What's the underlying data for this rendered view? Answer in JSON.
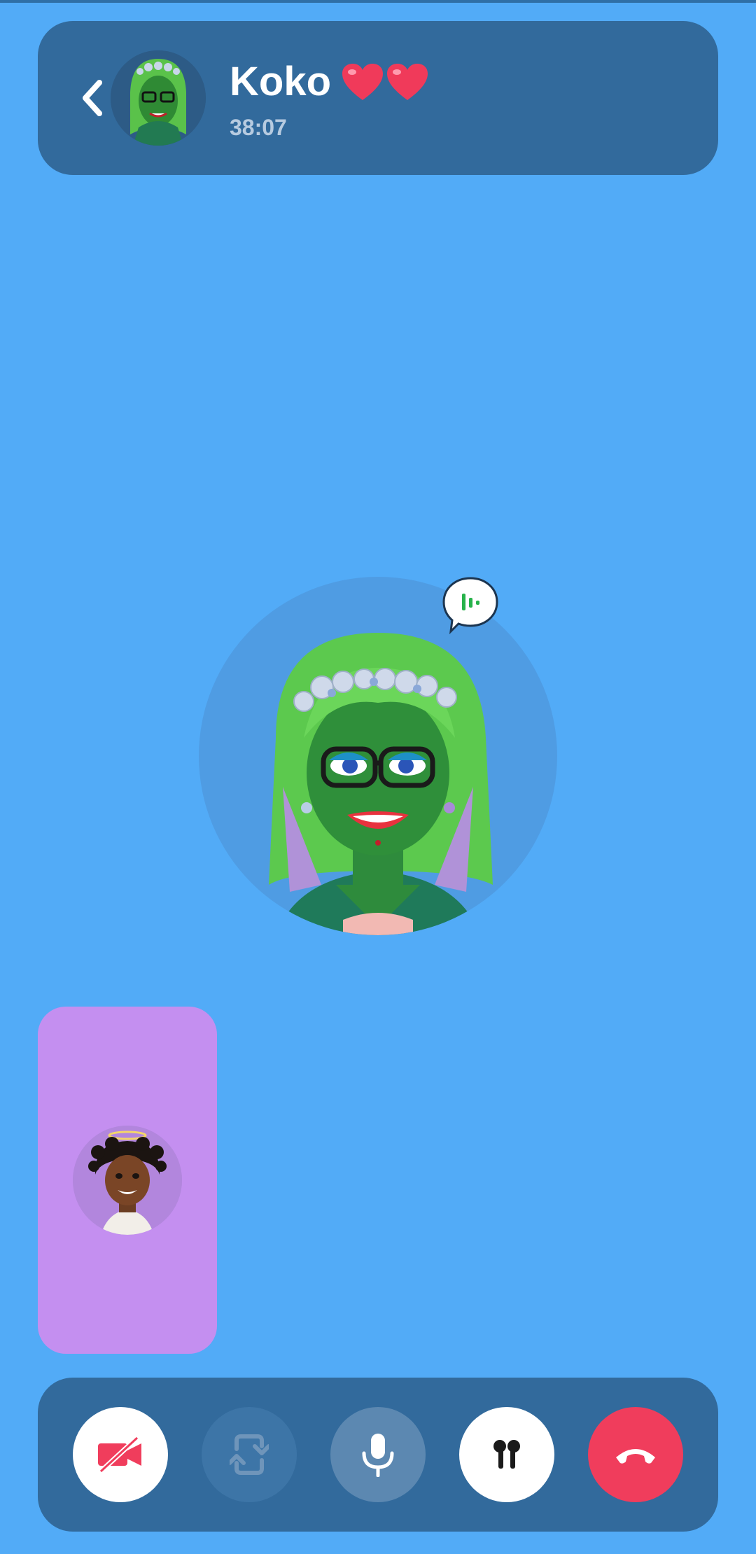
{
  "call": {
    "contact_name": "Koko",
    "hearts": "❤️❤️",
    "duration": "38:07"
  },
  "icons": {
    "back": "chevron-left-icon",
    "speaking": "speaking-bubble-icon",
    "camera_off": "video-off-icon",
    "flip": "flip-camera-icon",
    "mic": "microphone-icon",
    "audio": "earbuds-icon",
    "end": "end-call-icon"
  },
  "colors": {
    "background": "#52abf7",
    "panel": "#326a9c",
    "pip": "#c48ff0",
    "end_call": "#f03d5c",
    "camera_off": "#f03d5c"
  }
}
